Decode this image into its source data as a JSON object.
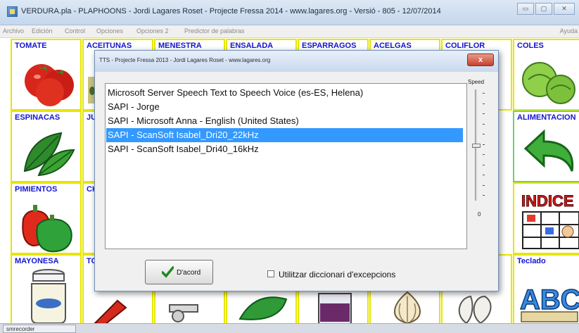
{
  "window": {
    "title": "VERDURA.pla - PLAPHOONS - Jordi Lagares Roset - Projecte Fressa 2014 - www.lagares.org - Versió - 805 - 12/07/2014",
    "minimize_glyph": "▭",
    "maximize_glyph": "▢",
    "close_glyph": "✕"
  },
  "menu": {
    "items": [
      "Archivo",
      "Edición",
      "Control",
      "Opciones",
      "Opciones 2",
      "Predictor de palabras"
    ],
    "help": "Ayuda"
  },
  "grid": {
    "row1": [
      "TOMATE",
      "ACEITUNAS",
      "MENESTRA",
      "ENSALADA",
      "ESPARRAGOS",
      "ACELGAS",
      "COLIFLOR",
      "COLES"
    ],
    "row2": [
      "ESPINACAS",
      "JU",
      "ALIMENTACION"
    ],
    "row3": [
      "PIMIENTOS",
      "CH"
    ],
    "row4": [
      "MAYONESA",
      "TO",
      "Teclado"
    ],
    "indice_text": "INDICE",
    "abc_text": "ABC",
    "colors": {
      "cell_border": "#e6e600",
      "label": "#1414d4",
      "active_border": "#6ad26a"
    }
  },
  "dialog": {
    "title": "TTS - Projecte Fressa 2013 - Jordi Lagares Roset - www.lagares.org",
    "close_glyph": "x",
    "voices": [
      "Microsoft Server Speech Text to Speech Voice (es-ES, Helena)",
      "SAPI - Jorge",
      "SAPI - Microsoft Anna - English (United States)",
      "SAPI - ScanSoft Isabel_Dri20_22kHz",
      "SAPI - ScanSoft Isabel_Dri40_16kHz"
    ],
    "selected_index": 3,
    "speed_label": "Speed",
    "speed_value": "0",
    "ok_label": "D'acord",
    "dictionary_label": "Utilitzar diccionari d'excepcions",
    "dictionary_checked": false,
    "selection_color": "#3399ff"
  },
  "taskbar": {
    "item": "smrecorder"
  }
}
